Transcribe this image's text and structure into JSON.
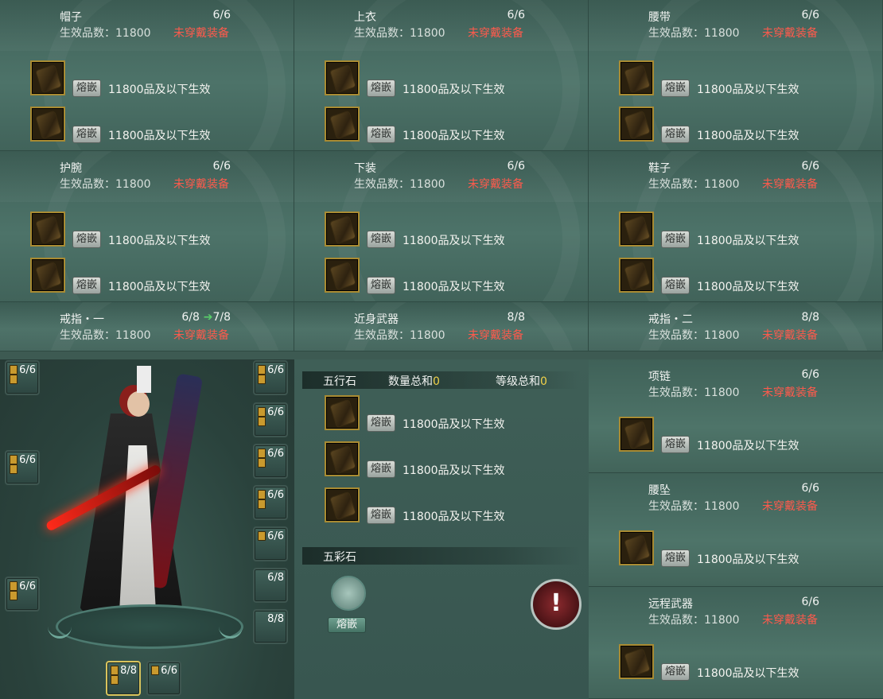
{
  "status_text": "未穿戴装备",
  "quality_label": "生效品数：11800",
  "inlay_label": "熔嵌",
  "slot_text": "11800品及以下生效",
  "panels": [
    {
      "name": "帽子",
      "count": "6/6"
    },
    {
      "name": "上衣",
      "count": "6/6"
    },
    {
      "name": "腰带",
      "count": "6/6"
    },
    {
      "name": "护腕",
      "count": "6/6"
    },
    {
      "name": "下装",
      "count": "6/6"
    },
    {
      "name": "鞋子",
      "count": "6/6"
    },
    {
      "name": "戒指・一",
      "count": "6/8",
      "upgrade": "7/8"
    },
    {
      "name": "近身武器",
      "count": "8/8"
    },
    {
      "name": "戒指・二",
      "count": "8/8"
    }
  ],
  "right_panels": [
    {
      "name": "项链",
      "count": "6/6"
    },
    {
      "name": "腰坠",
      "count": "6/6"
    },
    {
      "name": "远程武器",
      "count": "6/6"
    }
  ],
  "wuxing": {
    "title": "五行石",
    "qty_label": "数量总和",
    "qty_value": "0",
    "level_label": "等级总和",
    "level_value": "0"
  },
  "wucai": {
    "title": "五彩石",
    "button": "熔嵌"
  },
  "equip_slots_left": [
    "6/6",
    "6/6",
    "6/6"
  ],
  "equip_slots_right": [
    "6/6",
    "6/6",
    "6/6",
    "6/6",
    "6/6",
    "6/8",
    "8/8"
  ],
  "equip_slots_bottom": [
    "8/8",
    "6/6"
  ],
  "alert_icon": "!",
  "colors": {
    "status_red": "#ff5a4c",
    "accent_yellow": "#f1d24a",
    "arrow_green": "#59d06a"
  }
}
